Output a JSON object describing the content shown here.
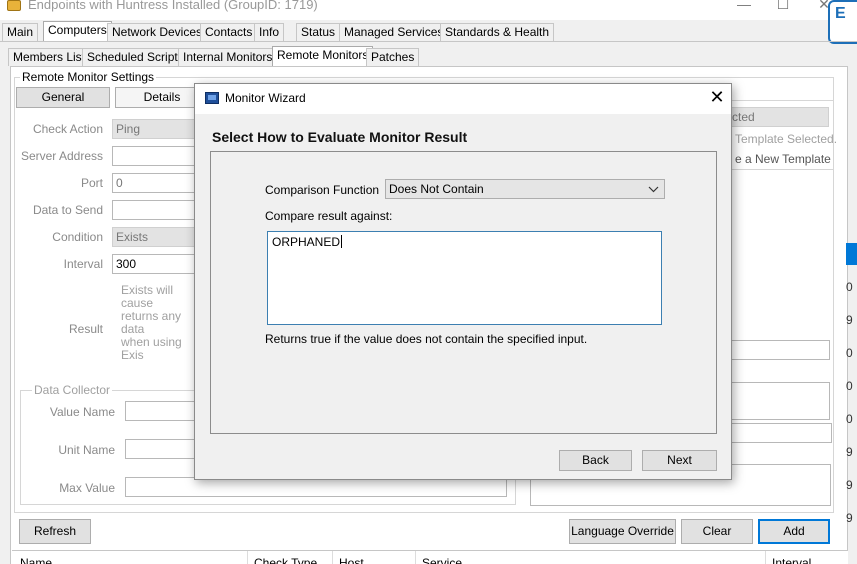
{
  "window": {
    "title": "Endpoints with Huntress Installed   (GroupID: 1719)",
    "minimize": "—",
    "maximize": "☐",
    "close": "✕",
    "side_logo": "E"
  },
  "main_tabs": [
    "Main",
    "Computers",
    "Network Devices",
    "Contacts",
    "Info",
    "Status",
    "Managed Services",
    "Standards & Health"
  ],
  "sub_tabs": [
    "Members List",
    "Scheduled Scripts",
    "Internal Monitors",
    "Remote Monitors",
    "Patches"
  ],
  "settings": {
    "group_title": "Remote Monitor Settings",
    "tab_general": "General",
    "tab_details": "Details",
    "labels": {
      "check_action": "Check Action",
      "server_address": "Server Address",
      "port": "Port",
      "data_to_send": "Data to Send",
      "condition": "Condition",
      "interval": "Interval",
      "result": "Result"
    },
    "values": {
      "check_action": "Ping",
      "server_address": "",
      "port": "0",
      "data_to_send": "",
      "condition": "Exists",
      "interval": "300"
    },
    "hint_lines": [
      "Exists will cause",
      "returns any data",
      "when using Exis"
    ]
  },
  "data_collector": {
    "title": "Data Collector",
    "value_name": "Value Name",
    "unit_name": "Unit Name",
    "max_value": "Max Value"
  },
  "template": {
    "select_value": "cted",
    "none_selected": "Template Selected.",
    "create_new": "e a New Template"
  },
  "right_side_marks": [
    "0",
    "9",
    "0",
    "0",
    "0",
    "9",
    "9",
    "9",
    "0"
  ],
  "bottom_buttons": {
    "refresh": "Refresh",
    "language_override": "Language Override",
    "clear": "Clear",
    "add": "Add"
  },
  "table_headers": [
    "Name",
    "Check Type",
    "Host",
    "Service",
    "Interval"
  ],
  "dialog": {
    "title": "Monitor Wizard",
    "close": "✕",
    "heading": "Select How to Evaluate Monitor Result",
    "comparison_label": "Comparison Function",
    "comparison_value": "Does Not Contain",
    "compare_label": "Compare result against:",
    "compare_value": "ORPHANED",
    "help_text": "Returns true if the value does not contain the specified input.",
    "back": "Back",
    "next": "Next"
  },
  "colors": {
    "accent": "#0078d7",
    "dialog_bg": "#f0f0f0",
    "textarea_border": "#3c7fb1"
  }
}
